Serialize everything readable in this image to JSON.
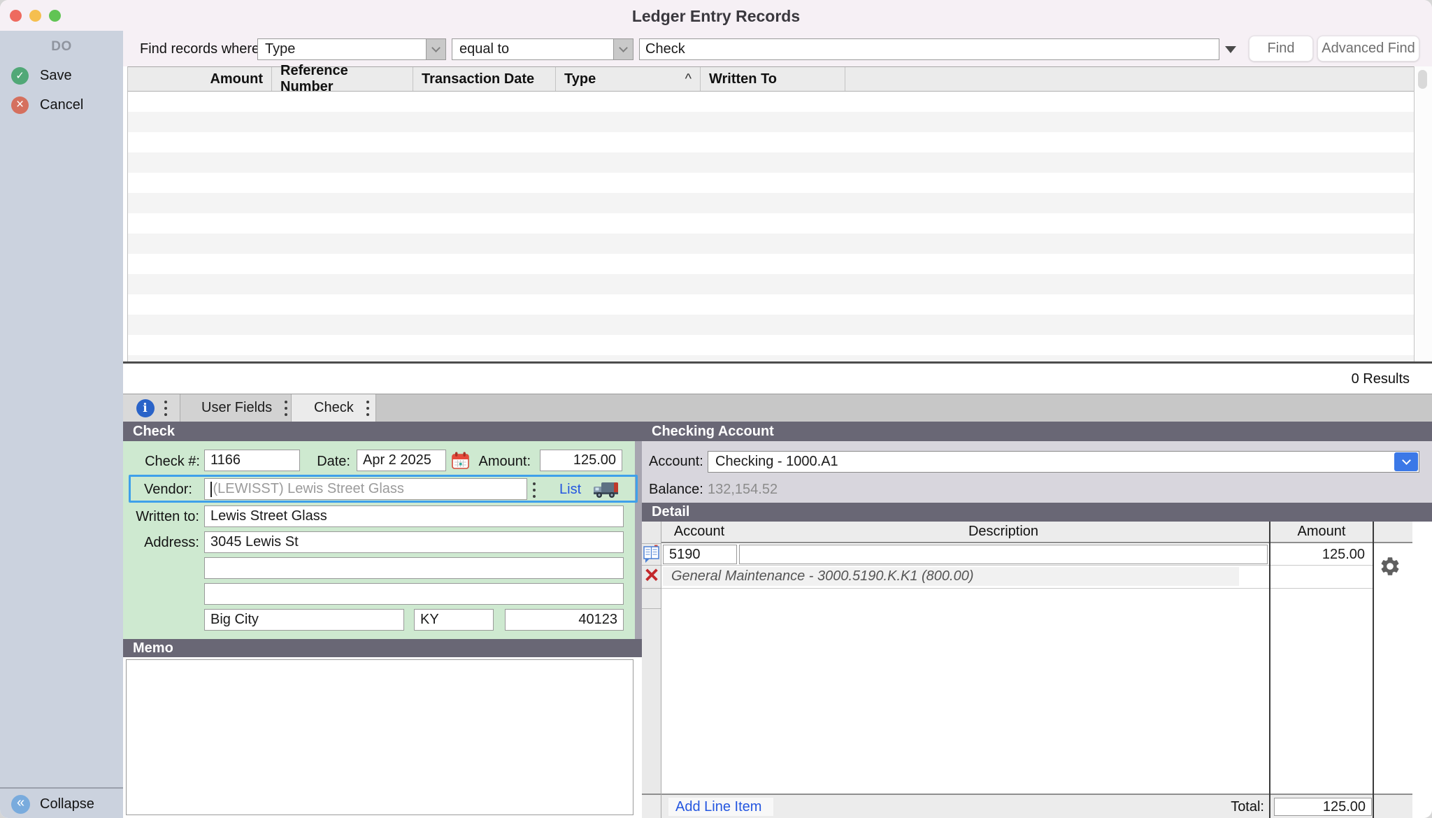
{
  "window": {
    "title": "Ledger Entry Records"
  },
  "sidebar": {
    "section_label": "DO",
    "save_label": "Save",
    "cancel_label": "Cancel",
    "collapse_label": "Collapse"
  },
  "find_bar": {
    "label": "Find records where",
    "field_dropdown_value": "Type",
    "operator_dropdown_value": "equal to",
    "search_value": "Check",
    "find_button": "Find",
    "advanced_find_button": "Advanced Find"
  },
  "records_table": {
    "columns": [
      "Amount",
      "Reference Number",
      "Transaction Date",
      "Type",
      "Written To"
    ],
    "sort_column": "Type",
    "sort_caret": "^",
    "results_count": "0 Results",
    "rows": []
  },
  "tabs": {
    "info_icon": "info-circle",
    "items": [
      {
        "label": "User Fields",
        "active": false
      },
      {
        "label": "Check",
        "active": true
      }
    ]
  },
  "check_panel": {
    "header": "Check",
    "check_number_label": "Check #:",
    "check_number": "1166",
    "date_label": "Date:",
    "date": "Apr 2 2025",
    "amount_label": "Amount:",
    "amount": "125.00",
    "vendor_label": "Vendor:",
    "vendor_value": "(LEWISST) Lewis Street Glass",
    "list_link": "List",
    "written_to_label": "Written to:",
    "written_to": "Lewis Street Glass",
    "address_label": "Address:",
    "address_line1": "3045 Lewis St",
    "address_line2": "",
    "address_line3": "",
    "city": "Big City",
    "state": "KY",
    "zip": "40123",
    "memo_header": "Memo",
    "memo": ""
  },
  "checking_account_panel": {
    "header": "Checking Account",
    "account_label": "Account:",
    "account_value": "Checking - 1000.A1",
    "balance_label": "Balance:",
    "balance_value": "132,154.52"
  },
  "detail_panel": {
    "header": "Detail",
    "columns": [
      "Account",
      "Description",
      "Amount"
    ],
    "line_items": [
      {
        "account": "5190",
        "description": "",
        "amount": "125.00",
        "account_full_name": "General Maintenance - 3000.5190.K.K1 (800.00)"
      }
    ],
    "add_line_item_label": "Add Line Item",
    "total_label": "Total:",
    "total_value": "125.00"
  },
  "icons": {
    "traffic_lights": [
      "close",
      "minimize",
      "zoom"
    ],
    "save_icon": "check-circle",
    "cancel_icon": "x-circle",
    "collapse_icon": "double-chevron-left-circle",
    "date_icon": "calendar",
    "vendor_list_icon": "truck",
    "line_item_icon": "ledger-book",
    "remove_line_icon": "red-x",
    "line_settings_icon": "gear"
  },
  "colors": {
    "titlebar_bg": "#f6f0f5",
    "sidebar_bg": "#cbd2de",
    "slate_header": "#696775",
    "form_green": "#cee9d0",
    "focus_blue": "#3fa0ea",
    "link_blue": "#2456e0",
    "dropdown_button_blue": "#3b78e7",
    "save_green": "#51a877",
    "cancel_red": "#d5705e",
    "collapse_blue": "#79abdd",
    "balance_text": "#8b8b8b"
  }
}
